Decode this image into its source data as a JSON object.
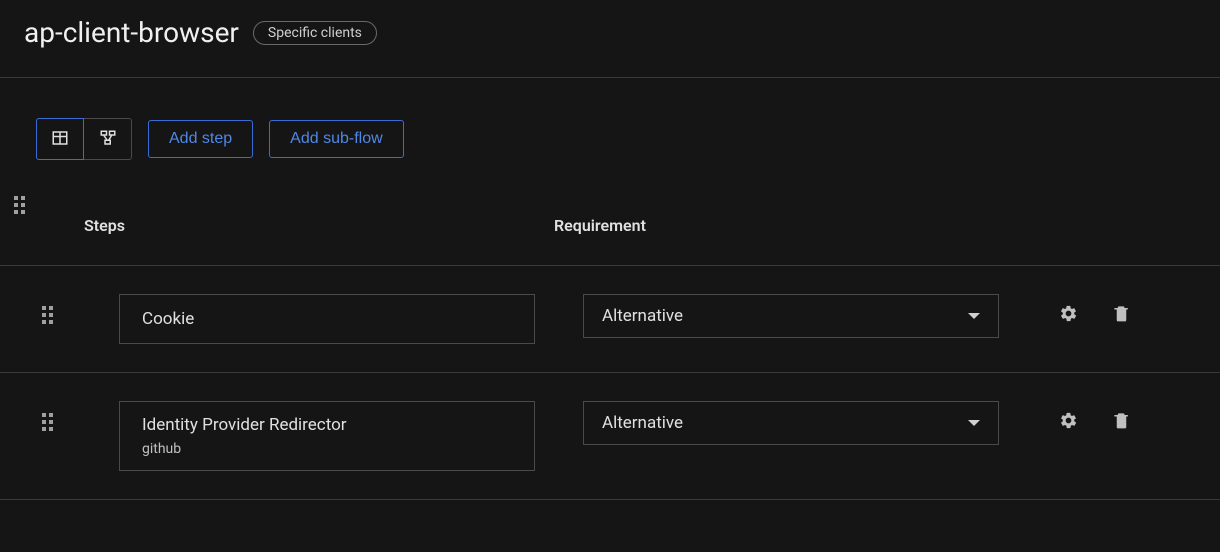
{
  "header": {
    "title": "ap-client-browser",
    "badge": "Specific clients"
  },
  "toolbar": {
    "add_step_label": "Add step",
    "add_subflow_label": "Add sub-flow"
  },
  "columns": {
    "steps": "Steps",
    "requirement": "Requirement"
  },
  "rows": [
    {
      "name": "Cookie",
      "sub": "",
      "requirement": "Alternative"
    },
    {
      "name": "Identity Provider Redirector",
      "sub": "github",
      "requirement": "Alternative"
    }
  ]
}
